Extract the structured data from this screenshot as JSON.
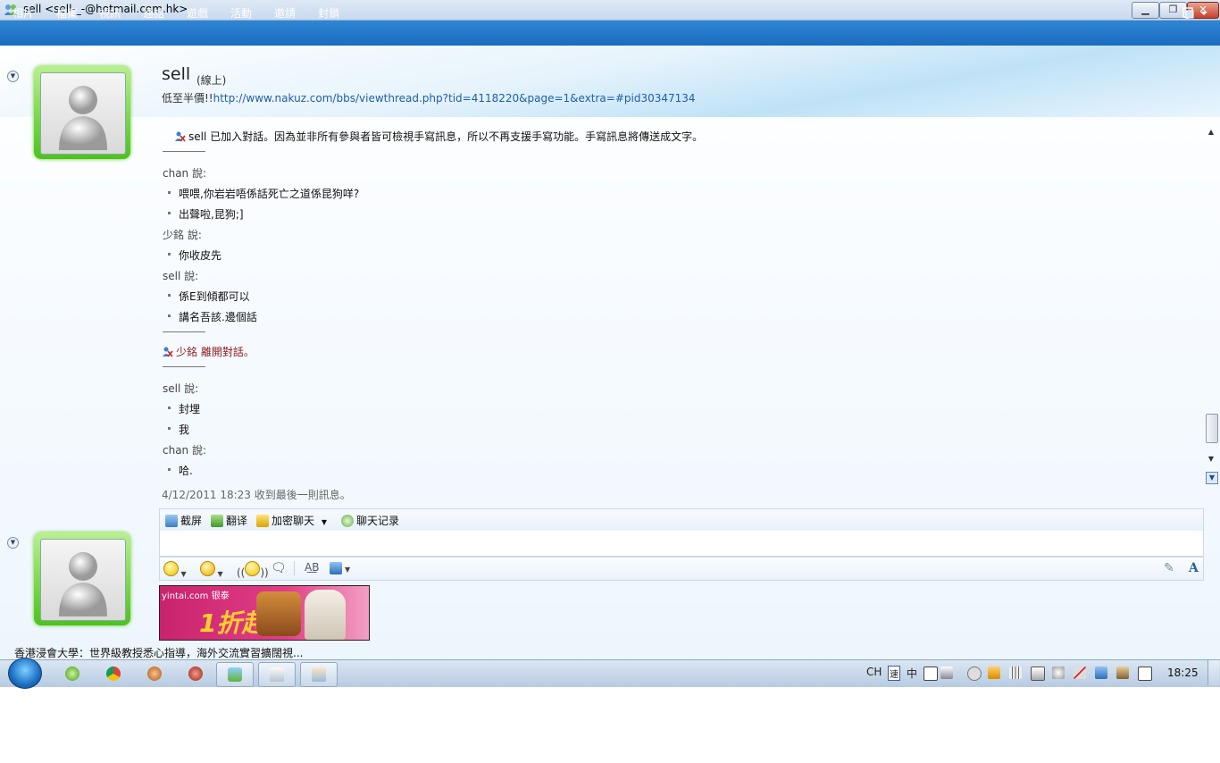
{
  "window": {
    "title": "sell <sell-_-@hotmail.com.hk>",
    "minimize_label": "▁",
    "maximize_label": "❐",
    "close_label": "✕"
  },
  "menu": {
    "items": [
      "相片",
      "檔案",
      "視訊",
      "通話",
      "遊戲",
      "活動",
      "邀請",
      "封鎖"
    ],
    "options_icon": "options-menu-icon"
  },
  "contact": {
    "name": "sell",
    "status": "(線上)",
    "message_prefix": "低至半價!!",
    "message_link": "http://www.nakuz.com/bbs/viewthread.php?tid=4118220&page=1&extra=#pid30347134"
  },
  "conversation": {
    "join_notice": "sell 已加入對話。因為並非所有參與者皆可檢視手寫訊息，所以不再支援手寫功能。手寫訊息將傳送成文字。",
    "blocks1": [
      {
        "speaker": "chan 說:",
        "messages": [
          "喂喂,你岩岩唔係話死亡之道係昆狗咩?",
          "出聲啦,昆狗;]"
        ]
      },
      {
        "speaker": "少銘 說:",
        "messages": [
          "你收皮先"
        ]
      },
      {
        "speaker": "sell 說:",
        "messages": [
          "係E到傾都可以",
          "講名吾該.邊個話"
        ]
      }
    ],
    "leave_name": "少銘",
    "leave_notice": "離開對話。",
    "blocks2": [
      {
        "speaker": "sell 說:",
        "messages": [
          "封埋",
          "我"
        ]
      },
      {
        "speaker": "chan 說:",
        "messages": [
          "哈."
        ]
      }
    ]
  },
  "last_received": "4/12/2011 18:23 收到最後一則訊息。",
  "toolbar": {
    "screenshot": "截屏",
    "translate": "翻译",
    "encrypt": "加密聊天",
    "history": "聊天记录"
  },
  "format_bar": {
    "icons": [
      "emoticon-icon",
      "wink-icon",
      "nudge-icon",
      "voice-clip-icon",
      "spell-check-icon",
      "background-icon",
      "handwriting-icon",
      "font-icon"
    ],
    "font_label": "A"
  },
  "ad": {
    "brand": "yintai.com 银泰",
    "headline": "1折起"
  },
  "news_text": "香港浸會大學：世界級教授悉心指導，海外交流實習擴闊視...",
  "taskbar": {
    "apps": [
      "start-orb",
      "app-green-icon",
      "chrome-icon",
      "app-orange-icon",
      "app-red-icon",
      "messenger-icon",
      "window-icon",
      "window2-icon"
    ],
    "tray_lang": "CH",
    "tray_ime1": "速",
    "tray_ime2": "中",
    "clock": "18:25",
    "colors": {
      "taskbar": "#c5d6ea",
      "menubar": "#1b6cc0",
      "accent_link": "#1d5fa6"
    }
  }
}
